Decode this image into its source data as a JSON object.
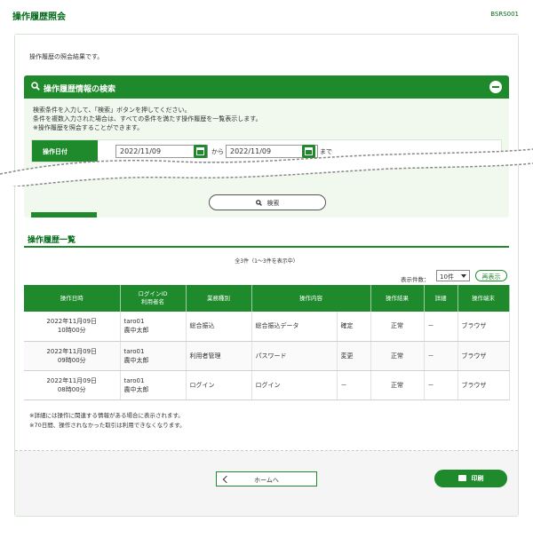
{
  "header": {
    "title": "操作履歴照会",
    "screen_id": "BSRS001"
  },
  "intro": "操作履歴の照会結果です。",
  "search": {
    "title": "操作履歴情報の検索",
    "desc": [
      "検索条件を入力して、「検索」ボタンを押してください。",
      "条件を複数入力された場合は、すべての条件を満たす操作履歴を一覧表示します。",
      "※操作履歴を照会することができます。"
    ],
    "date_label": "操作日付",
    "date_from": "2022/11/09",
    "date_from_sep": "から",
    "date_to": "2022/11/09",
    "date_to_sep": "まで",
    "button_label": "検索"
  },
  "list": {
    "title": "操作履歴一覧",
    "count_text": "全3件（1～3件を表示中）",
    "per_page_label": "表示件数：",
    "per_page_value": "10件",
    "redisplay_label": "再表示",
    "columns": {
      "datetime": "操作日時",
      "login_id": "ログインID",
      "user_name": "利用者名",
      "category": "業務種別",
      "content": "操作内容",
      "result": "操作結果",
      "detail": "詳細",
      "terminal": "操作端末"
    },
    "rows": [
      {
        "date": "2022年11月09日",
        "time": "10時00分",
        "login_id": "taro01",
        "user": "農中太郎",
        "category": "総合振込",
        "content": "総合振込データ",
        "action": "確定",
        "result": "正常",
        "detail": "－",
        "terminal": "ブラウザ"
      },
      {
        "date": "2022年11月09日",
        "time": "09時00分",
        "login_id": "taro01",
        "user": "農中太郎",
        "category": "利用者管理",
        "content": "パスワード",
        "action": "変更",
        "result": "正常",
        "detail": "－",
        "terminal": "ブラウザ"
      },
      {
        "date": "2022年11月09日",
        "time": "08時00分",
        "login_id": "taro01",
        "user": "農中太郎",
        "category": "ログイン",
        "content": "ログイン",
        "action": "－",
        "result": "正常",
        "detail": "－",
        "terminal": "ブラウザ"
      }
    ]
  },
  "notes": [
    "※詳細には操作に関連する情報がある場合に表示されます。",
    "※70日間、操作されなかった取引は利用できなくなります。"
  ],
  "footer": {
    "home_label": "ホームへ",
    "print_label": "印刷"
  },
  "colors": {
    "primary": "#1f8a2c",
    "title_green": "#006a17",
    "panel_bg": "#f1f9ee"
  },
  "icons": {
    "search": "magnifier-icon",
    "collapse": "minus-circle-icon",
    "calendar": "calendar-icon",
    "back": "chevron-left-icon",
    "print": "printer-icon"
  }
}
